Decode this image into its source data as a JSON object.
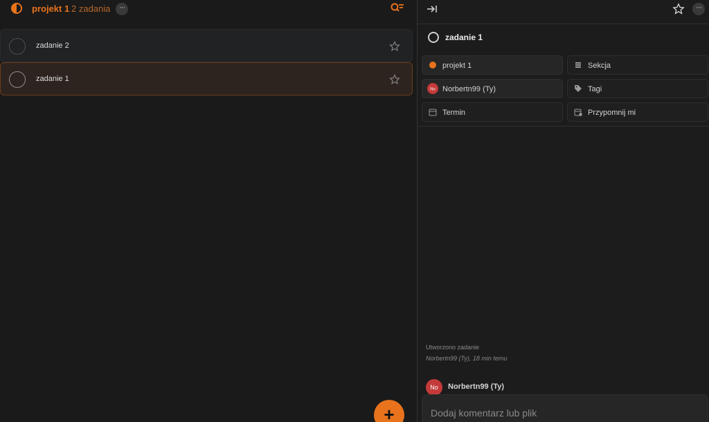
{
  "header": {
    "project_title": "projekt 1",
    "task_count": "2 zadania",
    "more_symbol": "···"
  },
  "tasks": [
    {
      "label": "zadanie 2",
      "selected": false
    },
    {
      "label": "zadanie 1",
      "selected": true
    }
  ],
  "fab": {
    "symbol": "+"
  },
  "detail": {
    "title": "zadanie 1",
    "more_symbol": "···",
    "props": {
      "project": "projekt 1",
      "section": "Sekcja",
      "assignee": "Norbertn99 (Ty)",
      "tags": "Tagi",
      "due": "Termin",
      "reminder": "Przypomnij mi"
    },
    "activity": {
      "created": "Utworzono zadanie",
      "created_by": "Norbertn99 (Ty), 18 min temu"
    },
    "comment": {
      "avatar_initials": "No",
      "user": "Norbertn99 (Ty)",
      "placeholder": "Dodaj komentarz lub plik"
    }
  },
  "colors": {
    "accent": "#e8731c",
    "avatar": "#c43a3a",
    "background": "#1a1a1a"
  }
}
